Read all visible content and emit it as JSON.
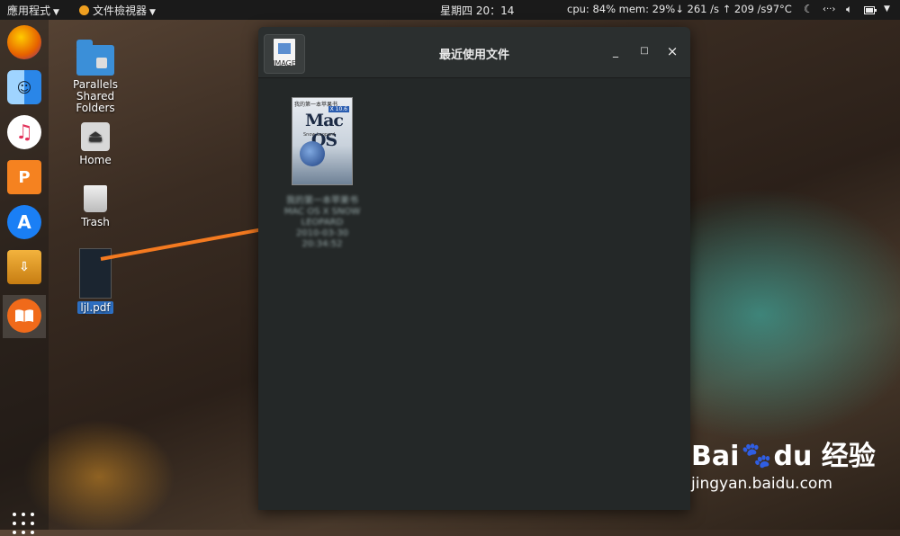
{
  "topbar": {
    "apps_menu": "應用程式",
    "active_app": "文件檢視器",
    "clock": "星期四 20：14",
    "system_stats": "cpu: 84% mem: 29%↓ 261 /s ↑ 209 /s97°C",
    "tray_icons": [
      "night-mode-icon",
      "network-icon",
      "volume-icon",
      "battery-icon"
    ]
  },
  "dock": {
    "items": [
      {
        "name": "firefox-icon",
        "label": "",
        "color": "#e66000"
      },
      {
        "name": "finder-icon",
        "label": "",
        "color": "#2a86e8"
      },
      {
        "name": "music-icon",
        "label": "♪",
        "color": "#ffffff"
      },
      {
        "name": "presentation-icon",
        "label": "P",
        "color": "#f58220"
      },
      {
        "name": "app-store-icon",
        "label": "A",
        "color": "#1a7ff5"
      },
      {
        "name": "usb-installer-icon",
        "label": "",
        "color": "#f0a020"
      },
      {
        "name": "book-reader-icon",
        "label": "",
        "color": "#f06a1a"
      }
    ]
  },
  "desktop": {
    "parallels": "Parallels\nShared\nFolders",
    "home": "Home",
    "trash": "Trash",
    "pdf_file": "ljl.pdf"
  },
  "window": {
    "title": "最近使用文件",
    "app_icon_label": "IMAGE",
    "minimize": "_",
    "maximize": "□",
    "close": "×",
    "recent_files": [
      {
        "name_line1": "我的第一本苹果书",
        "name_line2": "MAC OS X SNOW LEOPARD",
        "name_line3": "2010-03-30 20:34:52",
        "cover_header": "我的第一本苹果书",
        "cover_title": "Mac OS",
        "cover_version": "X 10.6",
        "cover_subtitle": "Snow Leopard"
      }
    ]
  },
  "watermark": {
    "logo_a": "Bai",
    "logo_b": "du",
    "logo_c": "经验",
    "url": "jingyan.baidu.com"
  }
}
